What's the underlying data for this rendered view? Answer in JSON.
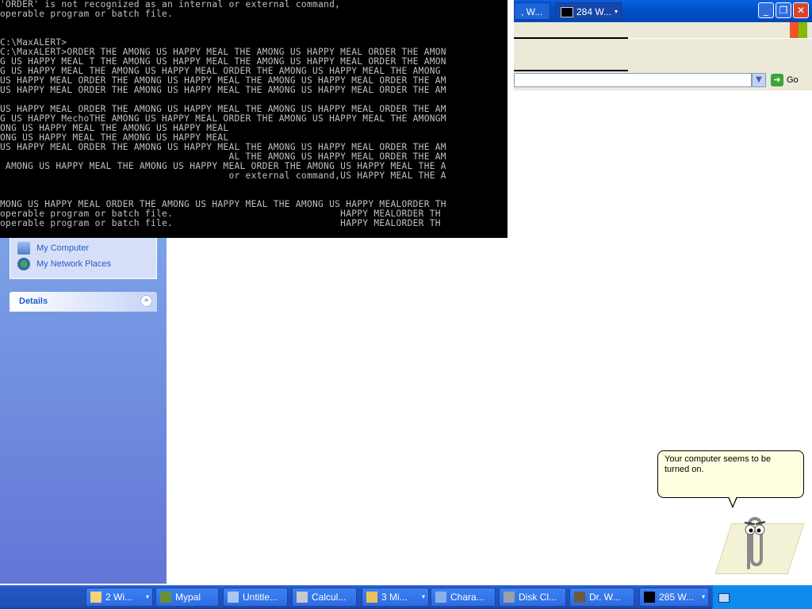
{
  "console": {
    "lines": [
      "'ORDER' is not recognized as an internal or external command,",
      "operable program or batch file.",
      "",
      "",
      "C:\\MaxALERT>",
      "C:\\MaxALERT>ORDER THE AMONG US HAPPY MEAL THE AMONG US HAPPY MEAL ORDER THE AMON",
      "G US HAPPY MEAL T THE AMONG US HAPPY MEAL THE AMONG US HAPPY MEAL ORDER THE AMON",
      "G US HAPPY MEAL THE AMONG US HAPPY MEAL ORDER THE AMONG US HAPPY MEAL THE AMONG",
      "US HAPPY MEAL ORDER THE AMONG US HAPPY MEAL THE AMONG US HAPPY MEAL ORDER THE AM",
      "US HAPPY MEAL ORDER THE AMONG US HAPPY MEAL THE AMONG US HAPPY MEAL ORDER THE AM",
      "",
      "US HAPPY MEAL ORDER THE AMONG US HAPPY MEAL THE AMONG US HAPPY MEAL ORDER THE AM",
      "G US HAPPY MechoTHE AMONG US HAPPY MEAL ORDER THE AMONG US HAPPY MEAL THE AMONGM",
      "ONG US HAPPY MEAL THE AMONG US HAPPY MEAL",
      "ONG US HAPPY MEAL THE AMONG US HAPPY MEAL",
      "US HAPPY MEAL ORDER THE AMONG US HAPPY MEAL THE AMONG US HAPPY MEAL ORDER THE AM",
      "                                         AL THE AMONG US HAPPY MEAL ORDER THE AM",
      " AMONG US HAPPY MEAL THE AMONG US HAPPY MEAL ORDER THE AMONG US HAPPY MEAL THE A",
      "                                         or external command,US HAPPY MEAL THE A",
      "",
      "",
      "MONG US HAPPY MEAL ORDER THE AMONG US HAPPY MEAL THE AMONG US HAPPY MEALORDER TH",
      "operable program or batch file.                              HAPPY MEALORDER TH",
      "operable program or batch file.                              HAPPY MEALORDER TH"
    ]
  },
  "explorer": {
    "tab1_label": ", W...",
    "tab2_label": "284 W...",
    "minimize_glyph": "_",
    "maximize_glyph": "❐",
    "close_glyph": "✕",
    "go_label": "Go",
    "dropdown_glyph": "▼"
  },
  "left_pane": {
    "places": [
      "My Computer",
      "My Network Places"
    ],
    "details_label": "Details",
    "details_chevron": "»"
  },
  "clippy": {
    "message": "Your computer seems to be turned on."
  },
  "taskbar": {
    "items": [
      {
        "label": "2 Wi...",
        "icon": "folder-icon",
        "grouped": true
      },
      {
        "label": "Mypal",
        "icon": "browser-icon",
        "grouped": false
      },
      {
        "label": "Untitle...",
        "icon": "notepad-icon",
        "grouped": false
      },
      {
        "label": "Calcul...",
        "icon": "calculator-icon",
        "grouped": false
      },
      {
        "label": "3 Mi...",
        "icon": "app-icon",
        "grouped": true
      },
      {
        "label": "Chara...",
        "icon": "charmap-icon",
        "grouped": false
      },
      {
        "label": "Disk Cl...",
        "icon": "disk-cleanup-icon",
        "grouped": false
      },
      {
        "label": "Dr. W...",
        "icon": "drwatson-icon",
        "grouped": false
      },
      {
        "label": "285 W...",
        "icon": "cmd-icon",
        "grouped": true
      }
    ],
    "caret_glyph": "▾"
  }
}
